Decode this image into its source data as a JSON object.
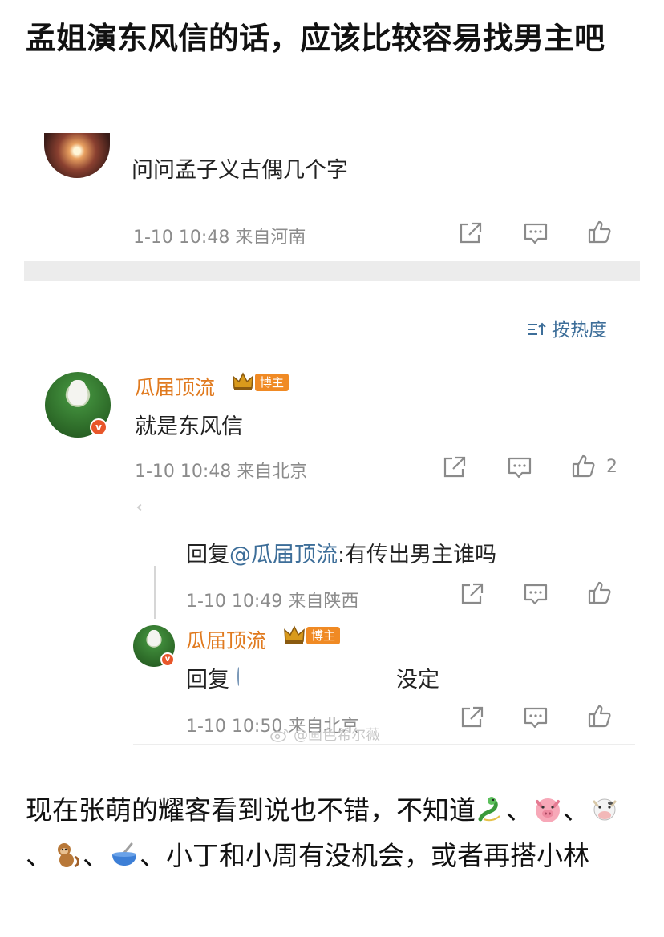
{
  "headline": "孟姐演东风信的话，应该比较容易找男主吧",
  "comment1": {
    "text": "问问孟子义古偶几个字",
    "meta": "1-10 10:48 来自河南"
  },
  "sort": {
    "label": "按热度"
  },
  "comment2": {
    "name": "瓜届顶流",
    "badge": "博主",
    "text": "就是东风信",
    "meta": "1-10 10:48 来自北京",
    "like_count": "2"
  },
  "reply1": {
    "prefix": "回复",
    "mention": "@瓜届顶流",
    "text": ":有传出男主谁吗",
    "meta": "1-10 10:49 来自陕西"
  },
  "reply2": {
    "name": "瓜届顶流",
    "badge": "博主",
    "prefix": "回复",
    "text": "没定",
    "meta": "1-10 10:50 来自北京"
  },
  "watermark": "@画色希尔薇",
  "footer": {
    "part1": "现在张萌的耀客看到说也不错，不知道",
    "sep": "、",
    "part2": "、小丁和小周有没机会，或者再搭小林",
    "emojis": [
      "dragon",
      "pig",
      "cow",
      "monkey",
      "bowl"
    ]
  },
  "colors": {
    "accent_blue": "#3d6e99",
    "name_orange": "#e07a1f",
    "badge_orange": "#f08a24",
    "verified_red": "#e8562a"
  }
}
